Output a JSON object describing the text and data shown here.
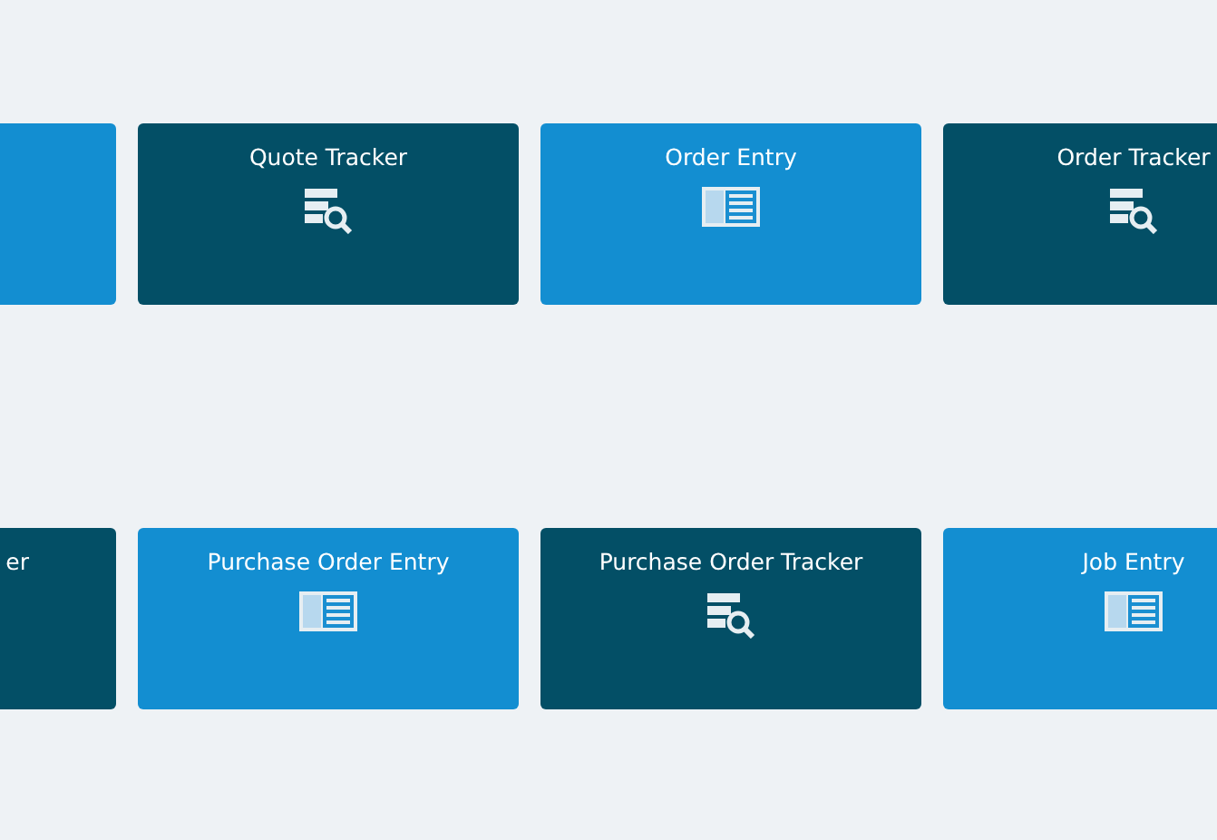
{
  "rows": [
    {
      "tiles": [
        {
          "color": "#138ed1"
        },
        {
          "kind": "tracker",
          "color": "#034f66",
          "title": "Quote Tracker"
        },
        {
          "kind": "entry",
          "color": "#138ed1",
          "title": "Order Entry"
        },
        {
          "kind": "tracker",
          "color": "#034f66",
          "title": "Order Tracker"
        }
      ]
    },
    {
      "tiles": [
        {
          "color": "#034f66",
          "title": "er"
        },
        {
          "kind": "entry",
          "color": "#138ed1",
          "title": "Purchase Order Entry"
        },
        {
          "kind": "tracker",
          "color": "#034f66",
          "title": "Purchase Order Tracker"
        },
        {
          "kind": "entry",
          "color": "#138ed1",
          "title": "Job Entry"
        }
      ]
    }
  ]
}
